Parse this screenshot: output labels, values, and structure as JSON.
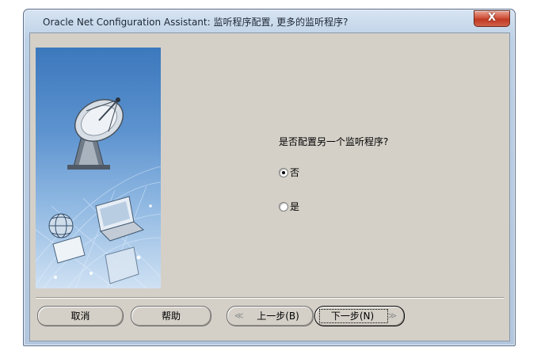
{
  "window": {
    "title": "Oracle Net Configuration Assistant: 监听程序配置, 更多的监听程序?",
    "close_label": "X"
  },
  "main": {
    "question": "是否配置另一个监听程序?",
    "options": [
      {
        "label": "否",
        "checked": true
      },
      {
        "label": "是",
        "checked": false
      }
    ]
  },
  "buttons": {
    "cancel": "取消",
    "help": "帮助",
    "back": "上一步(B)",
    "next": "下一步(N)",
    "back_arrow": "≪",
    "next_arrow": "≫"
  }
}
